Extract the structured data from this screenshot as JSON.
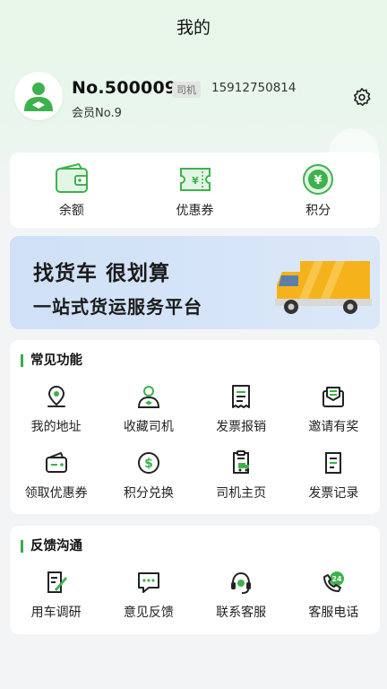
{
  "header": {
    "title": "我的"
  },
  "profile": {
    "user_no": "No.500009",
    "role": "司机",
    "phone": "15912750814",
    "member_level": "会员No.9"
  },
  "wallet": [
    {
      "label": "余额",
      "icon": "wallet-icon"
    },
    {
      "label": "优惠券",
      "icon": "coupon-icon"
    },
    {
      "label": "积分",
      "icon": "points-icon"
    }
  ],
  "banner": {
    "title": "找货车 很划算",
    "subtitle": "一站式货运服务平台"
  },
  "common_functions": {
    "title": "常见功能",
    "items": [
      {
        "label": "我的地址",
        "icon": "location-icon"
      },
      {
        "label": "收藏司机",
        "icon": "driver-icon"
      },
      {
        "label": "发票报销",
        "icon": "invoice-icon"
      },
      {
        "label": "邀请有奖",
        "icon": "invite-icon"
      },
      {
        "label": "领取优惠券",
        "icon": "coupon-wallet-icon"
      },
      {
        "label": "积分兑换",
        "icon": "dollar-icon"
      },
      {
        "label": "司机主页",
        "icon": "driver-home-icon"
      },
      {
        "label": "发票记录",
        "icon": "invoice-record-icon"
      }
    ]
  },
  "feedback": {
    "title": "反馈沟通",
    "items": [
      {
        "label": "用车调研",
        "icon": "survey-icon"
      },
      {
        "label": "意见反馈",
        "icon": "message-icon"
      },
      {
        "label": "联系客服",
        "icon": "headset-icon"
      },
      {
        "label": "客服电话",
        "icon": "phone-24-icon"
      }
    ]
  },
  "colors": {
    "accent": "#35b047",
    "banner_bg": "#d5e4f7",
    "truck": "#f5b21b"
  }
}
